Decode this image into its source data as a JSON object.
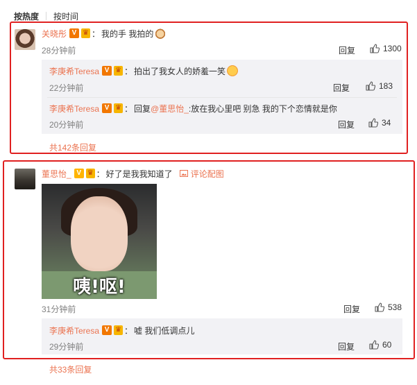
{
  "sort_tabs": {
    "hot": "按热度",
    "time": "按时间"
  },
  "comments": [
    {
      "user": "关晓彤",
      "colon": "：",
      "text": "我的手 我拍的",
      "time": "28分钟前",
      "reply": "回复",
      "likes": "1300",
      "replies": [
        {
          "user": "李庚希Teresa",
          "colon": "：",
          "text": "拍出了我女人的娇羞一笑",
          "time": "22分钟前",
          "reply": "回复",
          "likes": "183"
        },
        {
          "user": "李庚希Teresa",
          "colon": "：",
          "prefix": "回复",
          "mention": "@董思怡_",
          "text": ":放在我心里吧 别急 我的下个恋情就是你",
          "time": "20分钟前",
          "reply": "回复",
          "likes": "34"
        }
      ],
      "more": "共142条回复"
    },
    {
      "user": "董思怡_",
      "colon": "：",
      "text": "好了是我我知道了",
      "pic_link": "评论配图",
      "meme_caption": "咦!呕!",
      "time": "31分钟前",
      "reply": "回复",
      "likes": "538",
      "replies": [
        {
          "user": "李庚希Teresa",
          "colon": "：",
          "text": "嘘 我们低调点儿",
          "time": "29分钟前",
          "reply": "回复",
          "likes": "60"
        }
      ],
      "more": "共33条回复"
    }
  ],
  "colors": {
    "accent": "#eb7350",
    "highlight_box": "#e02020",
    "sub_panel": "#f2f2f5"
  },
  "icons": {
    "like": "thumbs-up-icon",
    "picture": "image-icon",
    "verified": "verified-v-icon",
    "level": "level-badge-icon"
  }
}
